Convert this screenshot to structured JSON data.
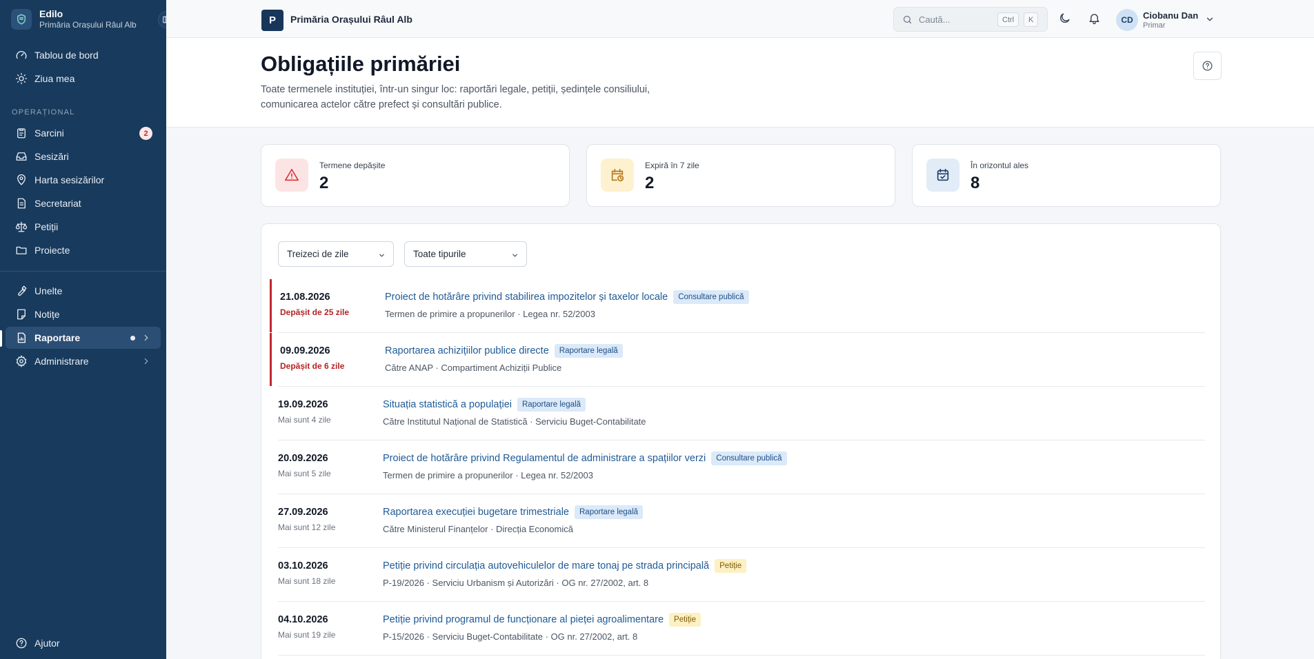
{
  "sidebar": {
    "app_name": "Edilo",
    "org": "Primăria Orașului Râul Alb",
    "section_label": "OPERAȚIONAL",
    "items": [
      {
        "label": "Tablou de bord",
        "icon": "gauge-icon"
      },
      {
        "label": "Ziua mea",
        "icon": "sun-icon"
      },
      {
        "label": "Sarcini",
        "icon": "clipboard-icon",
        "badge": "2"
      },
      {
        "label": "Sesizări",
        "icon": "inbox-icon"
      },
      {
        "label": "Harta sesizărilor",
        "icon": "map-pin-icon"
      },
      {
        "label": "Secretariat",
        "icon": "document-icon"
      },
      {
        "label": "Petiții",
        "icon": "scale-icon"
      },
      {
        "label": "Proiecte",
        "icon": "folder-icon"
      },
      {
        "label": "Unelte",
        "icon": "wrench-icon"
      },
      {
        "label": "Notițe",
        "icon": "note-icon"
      },
      {
        "label": "Raportare",
        "icon": "report-icon",
        "active": true
      },
      {
        "label": "Administrare",
        "icon": "gear-icon"
      }
    ],
    "help_label": "Ajutor"
  },
  "topbar": {
    "org_initial": "P",
    "org_name": "Primăria Orașului Râul Alb",
    "search_placeholder": "Caută...",
    "kbd_ctrl": "Ctrl",
    "kbd_k": "K",
    "user_initials": "CD",
    "user_name": "Ciobanu Dan",
    "user_role": "Primar"
  },
  "header": {
    "title": "Obligațiile primăriei",
    "description": "Toate termenele instituției, într-un singur loc: raportări legale, petiții, ședințele consiliului, comunicarea actelor către prefect și consultări publice."
  },
  "stats": [
    {
      "label": "Termene depășite",
      "value": "2",
      "color": "#d9363e",
      "bg": "#fde4e4"
    },
    {
      "label": "Expiră în 7 zile",
      "value": "2",
      "color": "#b7791f",
      "bg": "#fdf1cf"
    },
    {
      "label": "În orizontul ales",
      "value": "8",
      "color": "#1c3f66",
      "bg": "#e2ecf7"
    }
  ],
  "filters": {
    "period": "Treizeci de zile",
    "type": "Toate tipurile"
  },
  "obligations": [
    {
      "date": "21.08.2026",
      "status": "Depășit de 25 zile",
      "overdue": true,
      "title": "Proiect de hotărâre privind stabilirea impozitelor și taxelor locale",
      "tag": "Consultare publică",
      "tag_color": "blue",
      "sub": "Termen de primire a propunerilor · Legea nr. 52/2003"
    },
    {
      "date": "09.09.2026",
      "status": "Depășit de 6 zile",
      "overdue": true,
      "title": "Raportarea achizițiilor publice directe",
      "tag": "Raportare legală",
      "tag_color": "blue",
      "sub": "Către ANAP · Compartiment Achiziții Publice"
    },
    {
      "date": "19.09.2026",
      "status": "Mai sunt 4 zile",
      "overdue": false,
      "title": "Situația statistică a populației",
      "tag": "Raportare legală",
      "tag_color": "blue",
      "sub": "Către Institutul Național de Statistică · Serviciu Buget-Contabilitate"
    },
    {
      "date": "20.09.2026",
      "status": "Mai sunt 5 zile",
      "overdue": false,
      "title": "Proiect de hotărâre privind Regulamentul de administrare a spațiilor verzi",
      "tag": "Consultare publică",
      "tag_color": "blue",
      "sub": "Termen de primire a propunerilor · Legea nr. 52/2003"
    },
    {
      "date": "27.09.2026",
      "status": "Mai sunt 12 zile",
      "overdue": false,
      "title": "Raportarea execuției bugetare trimestriale",
      "tag": "Raportare legală",
      "tag_color": "blue",
      "sub": "Către Ministerul Finanțelor · Direcția Economică"
    },
    {
      "date": "03.10.2026",
      "status": "Mai sunt 18 zile",
      "overdue": false,
      "title": "Petiție privind circulația autovehiculelor de mare tonaj pe strada principală",
      "tag": "Petiție",
      "tag_color": "yellow",
      "sub": "P-19/2026 · Serviciu Urbanism și Autorizări · OG nr. 27/2002, art. 8"
    },
    {
      "date": "04.10.2026",
      "status": "Mai sunt 19 zile",
      "overdue": false,
      "title": "Petiție privind programul de funcționare al pieței agroalimentare",
      "tag": "Petiție",
      "tag_color": "yellow",
      "sub": "P-15/2026 · Serviciu Buget-Contabilitate · OG nr. 27/2002, art. 8"
    }
  ]
}
